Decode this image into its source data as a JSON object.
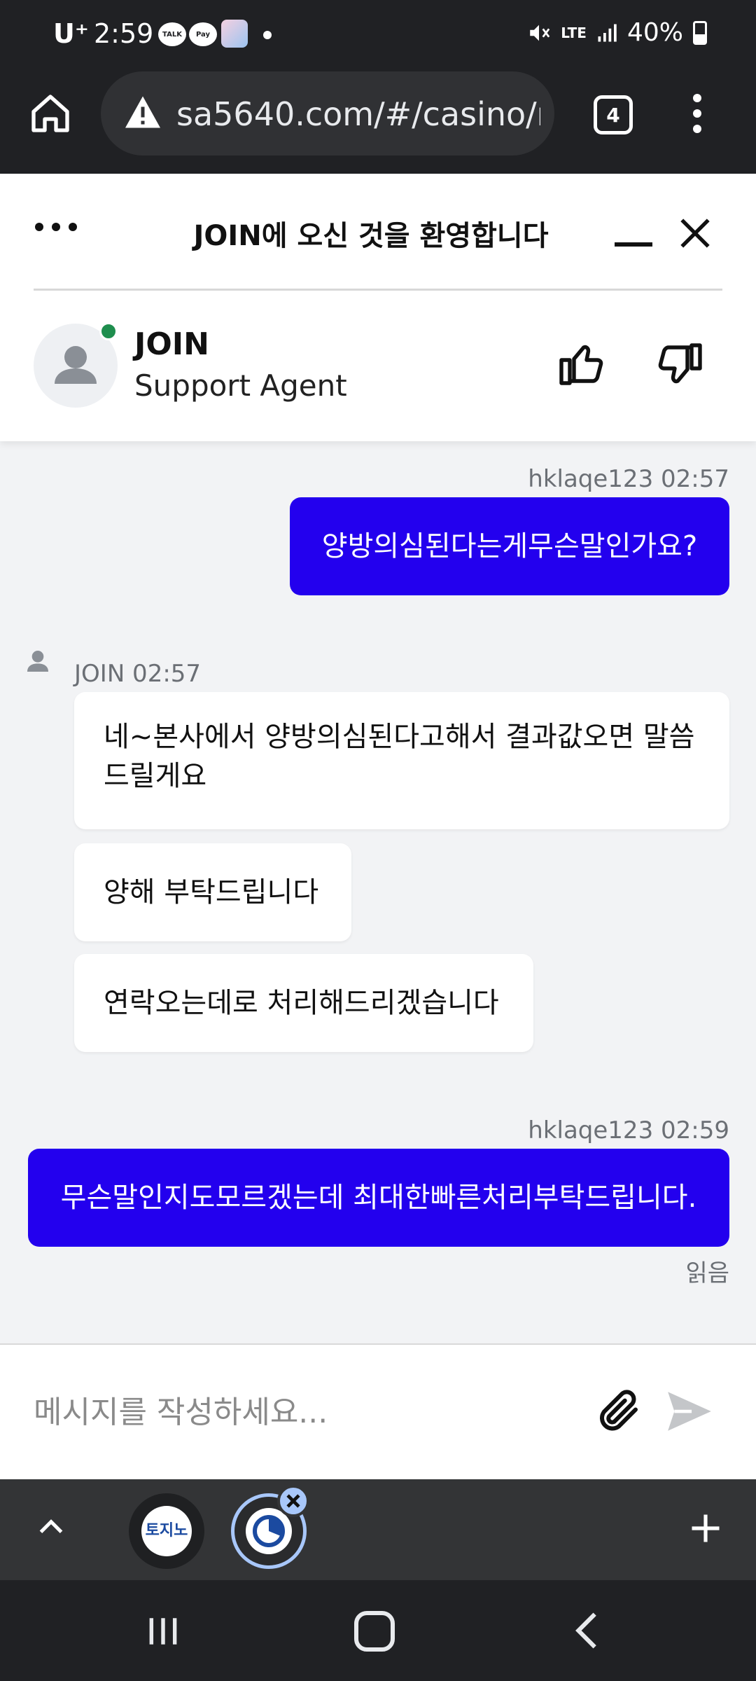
{
  "status_bar": {
    "carrier": "U⁺",
    "time": "2:59",
    "apps": [
      "TALK",
      "Pay"
    ],
    "network": "LTE",
    "battery": "40%"
  },
  "browser": {
    "url": "sa5640.com/#/casino/r",
    "tab_count": "4"
  },
  "chat": {
    "title": "JOIN에 오신 것을 환영합니다",
    "agent": {
      "name": "JOIN",
      "role": "Support Agent",
      "online": true
    },
    "messages": [
      {
        "direction": "out",
        "sender": "hklaqe123",
        "time": "02:57",
        "meta": "hklaqe123 02:57",
        "text": "양방의심된다는게무슨말인가요?"
      },
      {
        "direction": "in",
        "sender": "JOIN",
        "time": "02:57",
        "meta": "JOIN 02:57",
        "texts": [
          "네~본사에서 양방의심된다고해서 결과값오면 말씀드릴게요",
          "양해 부탁드립니다",
          "연락오는데로 처리해드리겠습니다"
        ]
      },
      {
        "direction": "out",
        "sender": "hklaqe123",
        "time": "02:59",
        "meta": "hklaqe123 02:59",
        "text": "무슨말인지도모르겠는데 최대한빠른처리부탁드립니다.",
        "receipt": "읽음"
      }
    ],
    "input": {
      "placeholder": "메시지를 작성하세요..."
    }
  },
  "tab_strip": {
    "tab1_label": "토지노"
  },
  "colors": {
    "outgoing_bubble": "#2300ee",
    "online_dot": "#1e8e4e",
    "browser_chrome": "#202124"
  },
  "icons": [
    "home-icon",
    "warning-icon",
    "tabs-icon",
    "more-vert-icon",
    "more-horiz-icon",
    "minimize-icon",
    "close-icon",
    "person-icon",
    "thumbs-up-icon",
    "thumbs-down-icon",
    "paperclip-icon",
    "send-icon",
    "chevron-up-icon",
    "plus-icon",
    "recents-icon",
    "nav-home-icon",
    "back-icon"
  ]
}
